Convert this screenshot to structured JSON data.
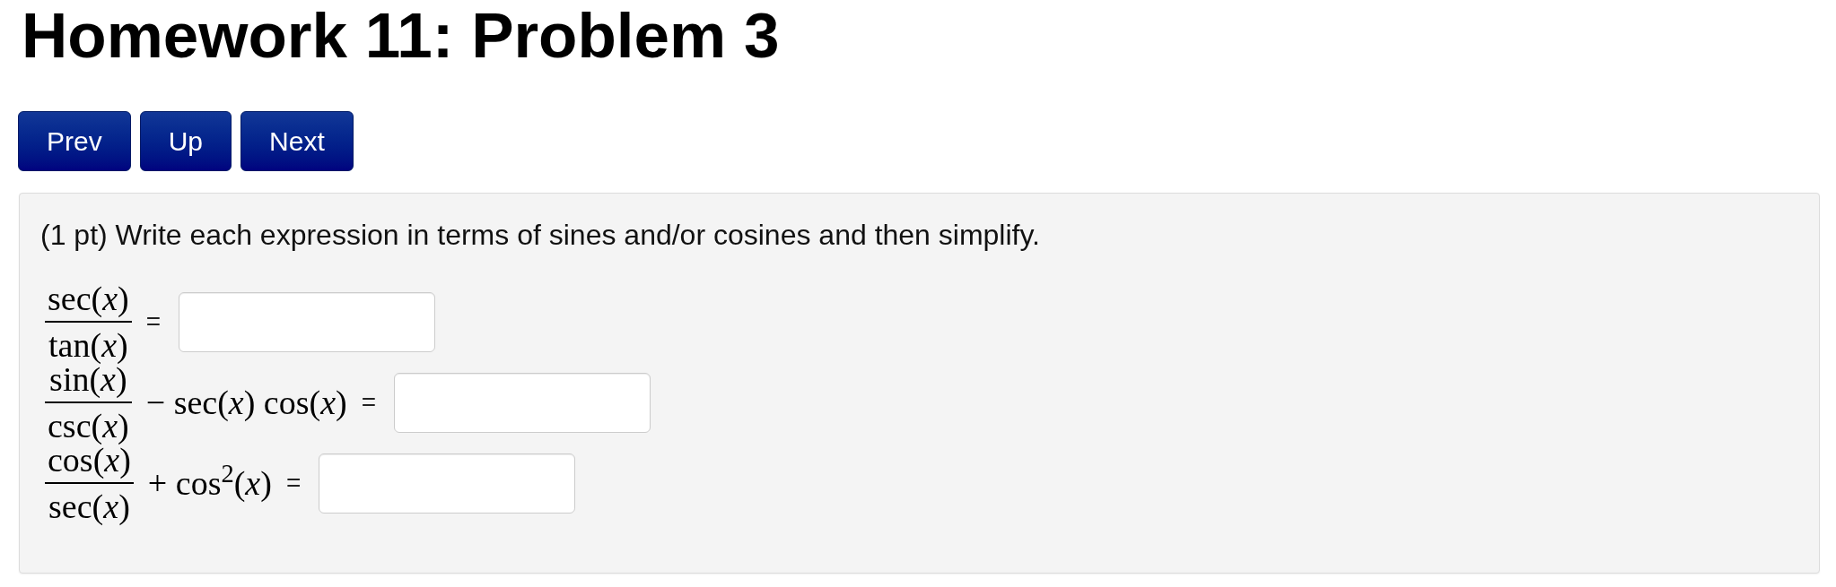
{
  "page_title": "Homework 11: Problem 3",
  "nav_buttons": [
    {
      "label": "Prev"
    },
    {
      "label": "Up"
    },
    {
      "label": "Next"
    }
  ],
  "problem": {
    "statement": "(1 pt) Write each expression in terms of sines and/or cosines and then simplify.",
    "equations": [
      {
        "numerator": "sec(*x*)",
        "denominator": "tan(*x*)",
        "equals": "="
      },
      {
        "numerator": "sin(*x*)",
        "denominator": "csc(*x*)",
        "term": "− sec(*x*) cos(*x*)",
        "equals": "="
      },
      {
        "numerator": "cos(*x*)",
        "denominator": "sec(*x*)",
        "term": "+ cos$^{2}$(*x*)",
        "equals": "="
      }
    ]
  }
}
